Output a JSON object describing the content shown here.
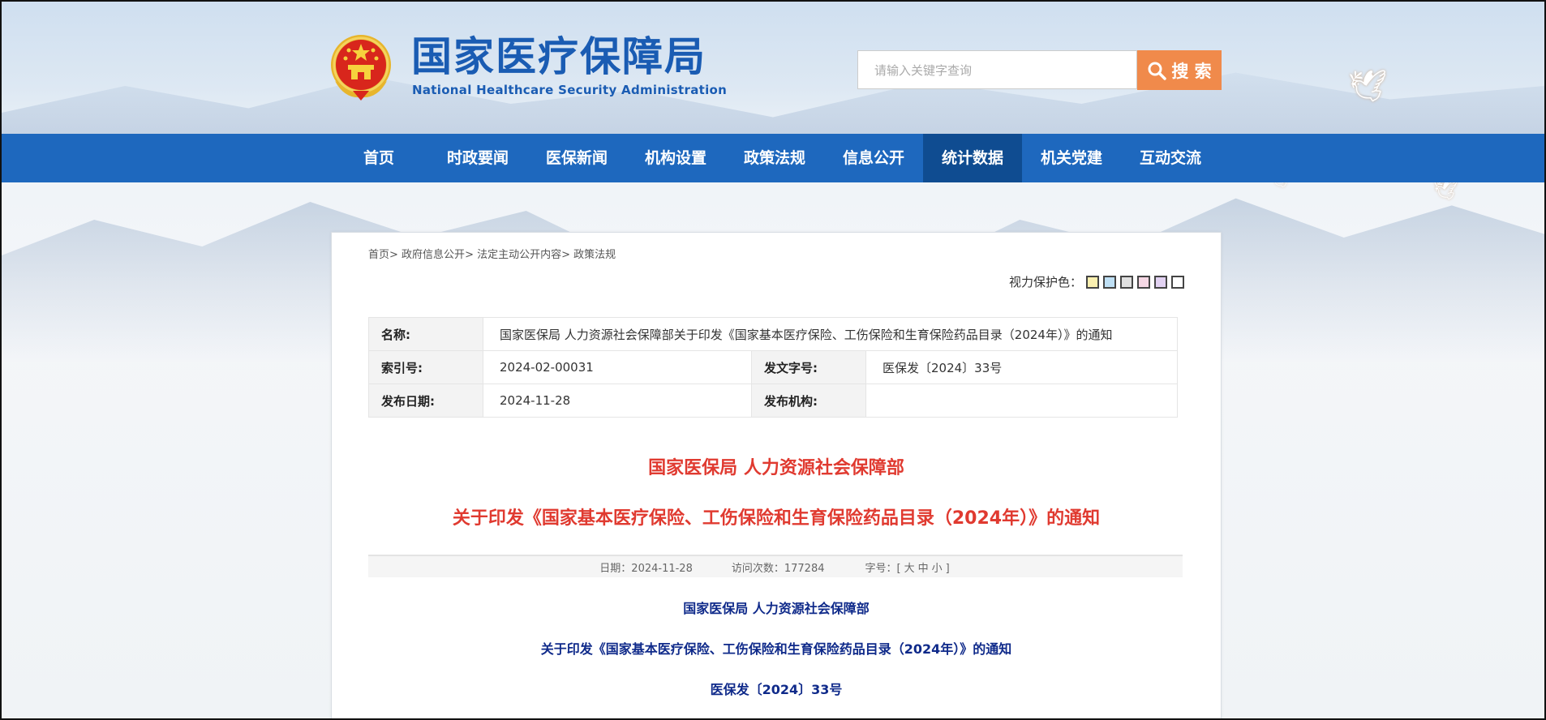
{
  "header": {
    "title": "国家医疗保障局",
    "subtitle": "National Healthcare Security Administration",
    "search_placeholder": "请输入关键字查询",
    "search_button": "搜 索"
  },
  "nav": {
    "items": [
      {
        "label": "首页"
      },
      {
        "label": "时政要闻"
      },
      {
        "label": "医保新闻"
      },
      {
        "label": "机构设置"
      },
      {
        "label": "政策法规"
      },
      {
        "label": "信息公开"
      },
      {
        "label": "统计数据",
        "active": true
      },
      {
        "label": "机关党建"
      },
      {
        "label": "互动交流"
      }
    ]
  },
  "breadcrumb": [
    "首页",
    "政府信息公开",
    "法定主动公开内容",
    "政策法规"
  ],
  "vision": {
    "label": "视力保护色：",
    "colors": [
      "#fbf0b0",
      "#bfe0f5",
      "#e0e0e0",
      "#f5d7e4",
      "#e2d2f2",
      "#ffffff"
    ]
  },
  "meta": {
    "name_label": "名称:",
    "name_value": "国家医保局 人力资源社会保障部关于印发《国家基本医疗保险、工伤保险和生育保险药品目录（2024年）》的通知",
    "index_label": "索引号:",
    "index_value": "2024-02-00031",
    "docno_label": "发文字号:",
    "docno_value": "医保发〔2024〕33号",
    "date_label": "发布日期:",
    "date_value": "2024-11-28",
    "org_label": "发布机构:",
    "org_value": ""
  },
  "article": {
    "title_line1": "国家医保局 人力资源社会保障部",
    "title_line2": "关于印发《国家基本医疗保险、工伤保险和生育保险药品目录（2024年）》的通知",
    "info_date": "日期：2024-11-28",
    "info_visits": "访问次数：177284",
    "font_label": "字号：[",
    "font_large": "大",
    "font_medium": "中",
    "font_small": "小",
    "font_close": "]",
    "body_line1": "国家医保局 人力资源社会保障部",
    "body_line2": "关于印发《国家基本医疗保险、工伤保险和生育保险药品目录（2024年）》的通知",
    "body_line3": "医保发〔2024〕33号"
  }
}
